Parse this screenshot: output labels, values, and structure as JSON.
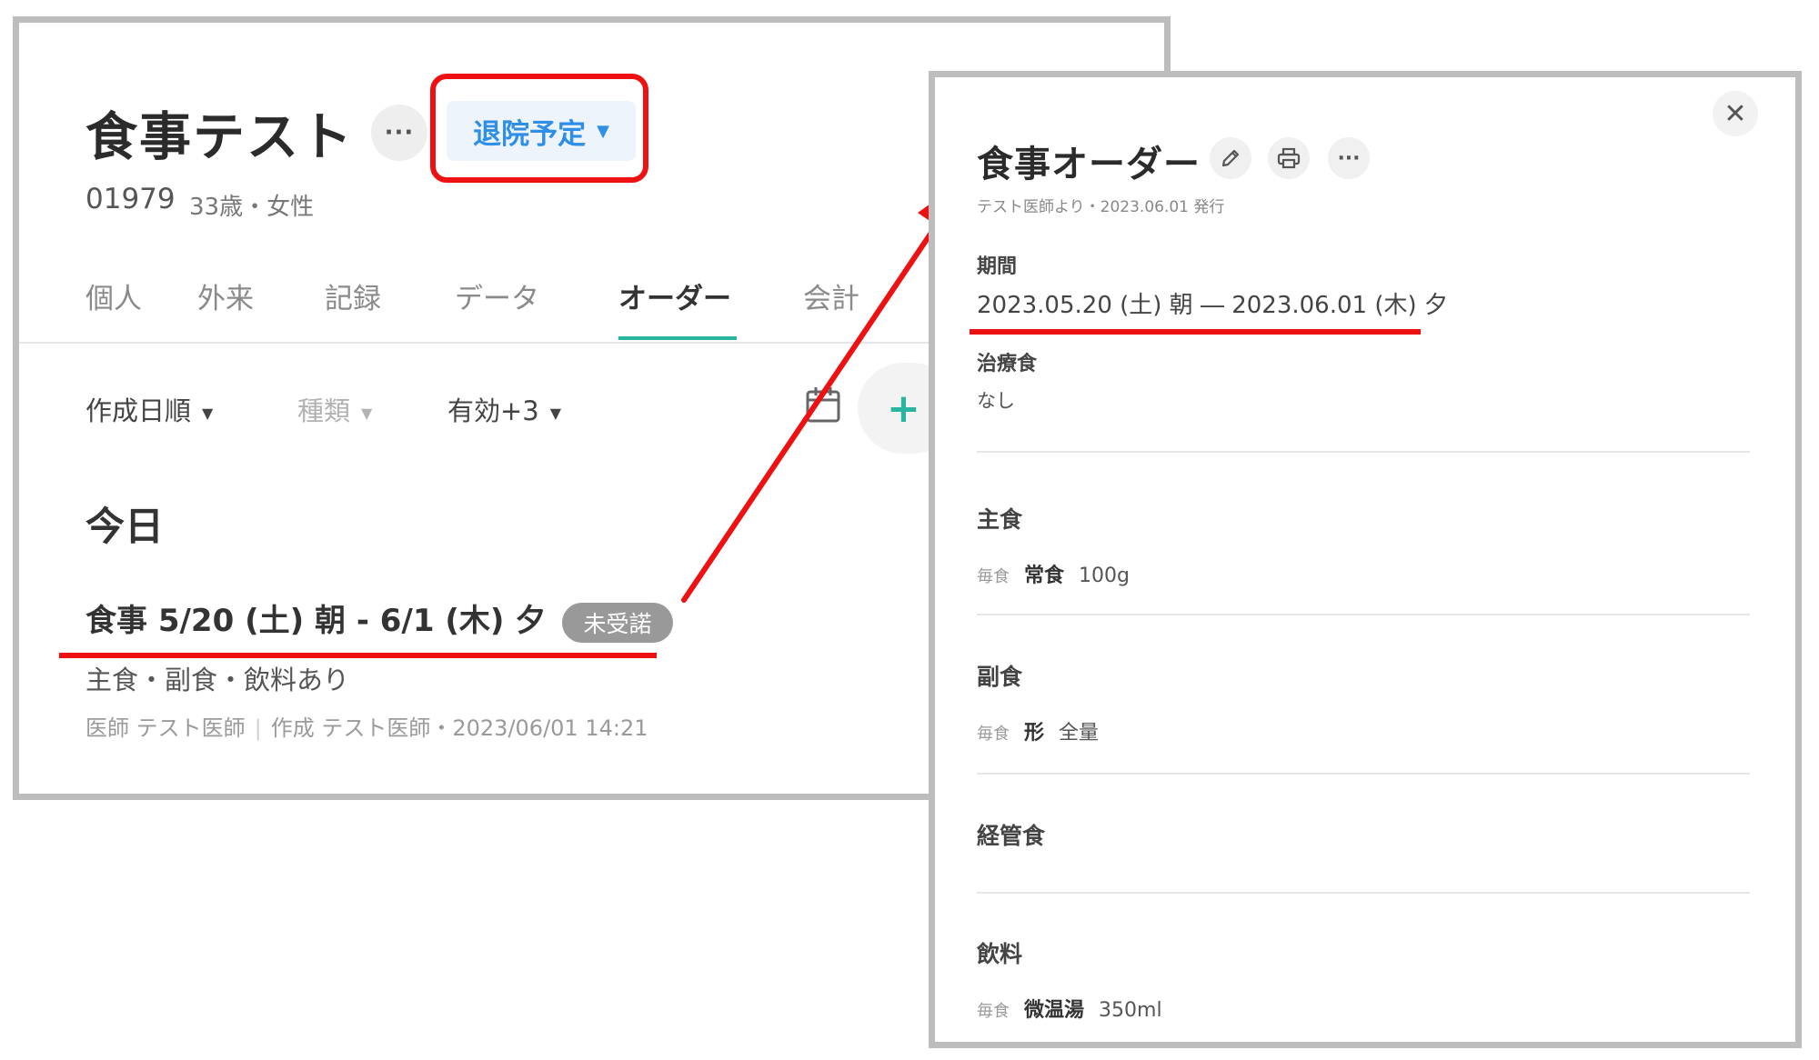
{
  "patient": {
    "name": "食事テスト",
    "more_label": "···",
    "status": "退院予定",
    "id": "01979",
    "age_sex": "33歳・女性"
  },
  "tabs": [
    {
      "label": "個人"
    },
    {
      "label": "外来"
    },
    {
      "label": "記録"
    },
    {
      "label": "データ"
    },
    {
      "label": "オーダー"
    },
    {
      "label": "会計"
    }
  ],
  "filters": [
    {
      "label": "作成日順"
    },
    {
      "label": "種類"
    },
    {
      "label": "有効+3"
    }
  ],
  "add_label": "+",
  "section_title": "今日",
  "order": {
    "title": "食事  5/20 (土) 朝 - 6/1 (木) 夕",
    "badge": "未受諾",
    "summary": "主食・副食・飲料あり",
    "doctor": "医師 テスト医師",
    "created": "作成 テスト医師・2023/06/01 14:21"
  },
  "detail": {
    "close_label": "✕",
    "title": "食事オーダー",
    "issued": "テスト医師より・2023.06.01 発行",
    "period_label": "期間",
    "period_value": "2023.05.20 (土) 朝 ― 2023.06.01 (木) 夕",
    "therapeutic_label": "治療食",
    "therapeutic_value": "なし",
    "staple": {
      "label": "主食",
      "freq": "毎食",
      "name": "常食",
      "amount": "100g"
    },
    "side": {
      "label": "副食",
      "freq": "毎食",
      "name": "形",
      "amount": "全量"
    },
    "tube_label": "経管食",
    "drink": {
      "label": "飲料",
      "freq": "毎食",
      "name": "微温湯",
      "amount": "350ml"
    }
  },
  "colors": {
    "accent_teal": "#2ab5a0",
    "status_blue": "#2f8ee6",
    "annotation_red": "#ee1111",
    "panel_border": "#bdbdbd"
  },
  "icons": [
    "more-icon",
    "caret-down-icon",
    "calendar-icon",
    "plus-icon",
    "close-icon",
    "pencil-icon",
    "printer-icon"
  ]
}
